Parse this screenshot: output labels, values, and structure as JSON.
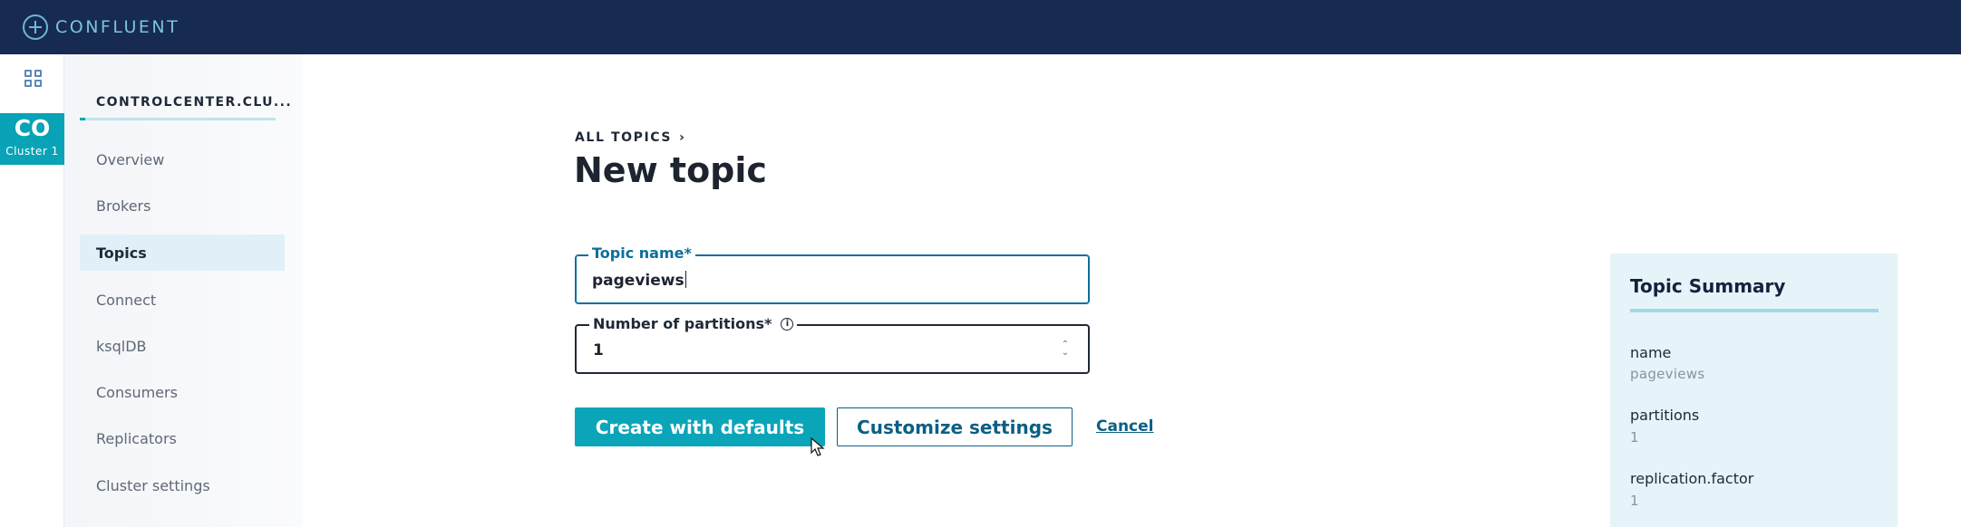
{
  "brand": {
    "name": "CONFLUENT"
  },
  "rail": {
    "cluster_abbr": "CO",
    "cluster_label": "Cluster 1"
  },
  "nav": {
    "cluster_name": "CONTROLCENTER.CLU...",
    "items": [
      {
        "label": "Overview",
        "active": false
      },
      {
        "label": "Brokers",
        "active": false
      },
      {
        "label": "Topics",
        "active": true
      },
      {
        "label": "Connect",
        "active": false
      },
      {
        "label": "ksqlDB",
        "active": false
      },
      {
        "label": "Consumers",
        "active": false
      },
      {
        "label": "Replicators",
        "active": false
      },
      {
        "label": "Cluster settings",
        "active": false
      }
    ]
  },
  "main": {
    "breadcrumb": "ALL TOPICS",
    "title": "New topic",
    "topic_name": {
      "label": "Topic name*",
      "value": "pageviews"
    },
    "partitions": {
      "label": "Number of partitions*",
      "value": "1"
    },
    "buttons": {
      "create": "Create with defaults",
      "customize": "Customize settings",
      "cancel": "Cancel"
    }
  },
  "summary": {
    "title": "Topic Summary",
    "rows": [
      {
        "key": "name",
        "value": "pageviews"
      },
      {
        "key": "partitions",
        "value": "1"
      },
      {
        "key": "replication.factor",
        "value": "1"
      }
    ]
  },
  "colors": {
    "topbar": "#162a52",
    "accent": "#0aa5b9",
    "link": "#0b5f84",
    "focus": "#0b6f9a",
    "summary_bg": "#e6f3f9"
  },
  "icons": [
    "confluent-logo-icon",
    "apps-grid-icon",
    "info-icon",
    "stepper-icon",
    "mouse-cursor-icon"
  ]
}
